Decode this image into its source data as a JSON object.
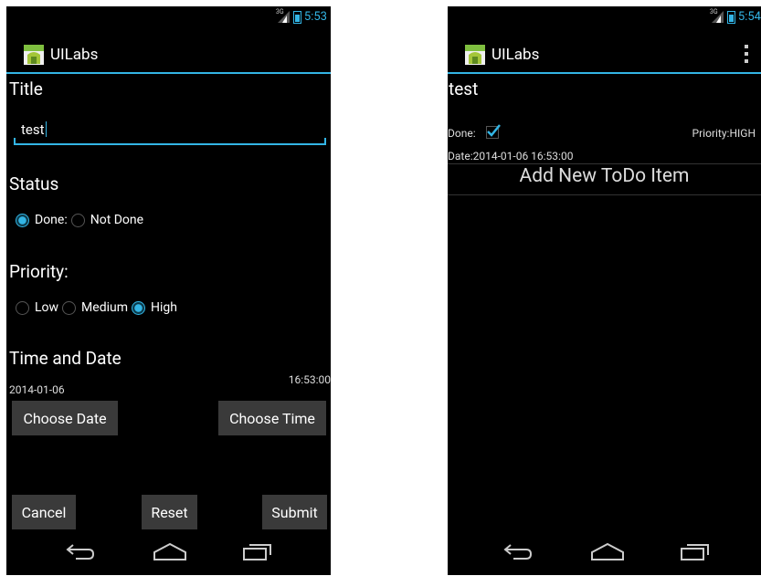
{
  "left_screen": {
    "status_bar": {
      "network": "3G",
      "time": "5:53"
    },
    "action_bar": {
      "title": "UILabs"
    },
    "title_label": "Title",
    "title_input_value": "test",
    "status_label": "Status",
    "status_options": [
      {
        "label": "Done:",
        "selected": true
      },
      {
        "label": "Not Done",
        "selected": false
      }
    ],
    "priority_label": "Priority:",
    "priority_options": [
      {
        "label": "Low",
        "selected": false
      },
      {
        "label": "Medium",
        "selected": false
      },
      {
        "label": "High",
        "selected": true
      }
    ],
    "time_date_label": "Time and Date",
    "date_value": "2014-01-06",
    "time_value": "16:53:00",
    "buttons": {
      "choose_date": "Choose Date",
      "choose_time": "Choose Time",
      "cancel": "Cancel",
      "reset": "Reset",
      "submit": "Submit"
    }
  },
  "right_screen": {
    "status_bar": {
      "network": "3G",
      "time": "5:54"
    },
    "action_bar": {
      "title": "UILabs"
    },
    "item": {
      "title": "test",
      "done_label": "Done:",
      "done_checked": true,
      "priority": "Priority:HIGH",
      "date": "Date:2014-01-06 16:53:00"
    },
    "add_item_label": "Add New ToDo Item"
  },
  "colors": {
    "accent": "#33b5e5",
    "background": "#000000",
    "button": "#3a3a3a"
  },
  "icons": {
    "app": "android-app-icon",
    "back": "back-arrow-icon",
    "home": "home-icon",
    "recents": "recent-apps-icon",
    "overflow": "overflow-menu-icon"
  }
}
